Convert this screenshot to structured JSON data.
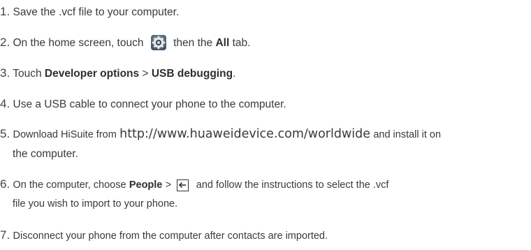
{
  "steps": [
    {
      "num": "1.",
      "text": "Save the .vcf file to your computer."
    },
    {
      "num": "2.",
      "pre": "On the home screen, touch",
      "icon": "settings-gear-icon",
      "mid": "then the",
      "bold": "All",
      "post": "tab."
    },
    {
      "num": "3.",
      "pre": "Touch",
      "bold1": "Developer options",
      "sep": ">",
      "bold2": "USB debugging",
      "post": "."
    },
    {
      "num": "4.",
      "text": "Use a USB cable to connect your phone to the computer."
    },
    {
      "num": "5.",
      "pre": "Download HiSuite from",
      "url": "http://www.huaweidevice.com/worldwide",
      "post": "and install it on",
      "cont": "the computer."
    },
    {
      "num": "6.",
      "pre": "On the computer, choose",
      "bold": "People",
      "sep": ">",
      "icon": "import-arrow-icon",
      "post": "and follow the instructions to select the .vcf",
      "cont": "file you wish to import to your phone."
    },
    {
      "num": "7.",
      "text": "Disconnect your phone from the computer after contacts are imported."
    }
  ]
}
